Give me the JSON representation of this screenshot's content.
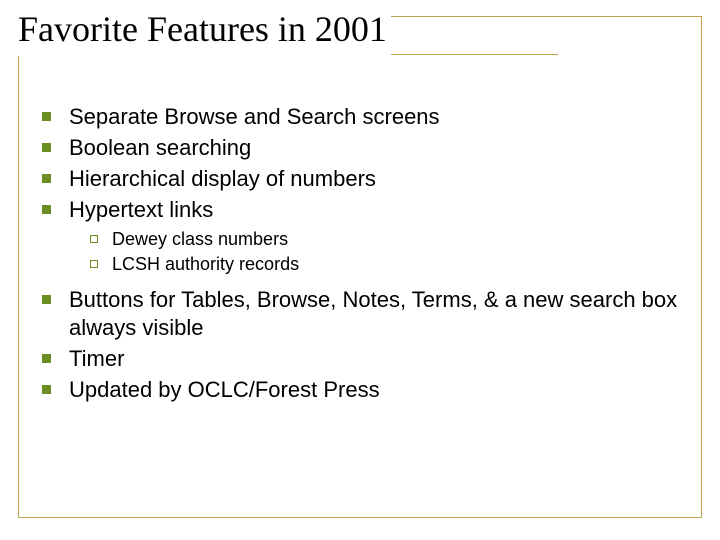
{
  "title": "Favorite Features in 2001",
  "bullets1": [
    {
      "text": "Separate Browse and Search screens"
    },
    {
      "text": "Boolean searching"
    },
    {
      "text": "Hierarchical display of numbers"
    },
    {
      "text": "Hypertext links"
    }
  ],
  "subbullets": [
    {
      "text": "Dewey class numbers"
    },
    {
      "text": "LCSH authority records"
    }
  ],
  "bullets2": [
    {
      "text": "Buttons for Tables, Browse, Notes, Terms, & a new search box always visible"
    },
    {
      "text": "Timer"
    },
    {
      "text": "Updated by OCLC/Forest Press"
    }
  ]
}
